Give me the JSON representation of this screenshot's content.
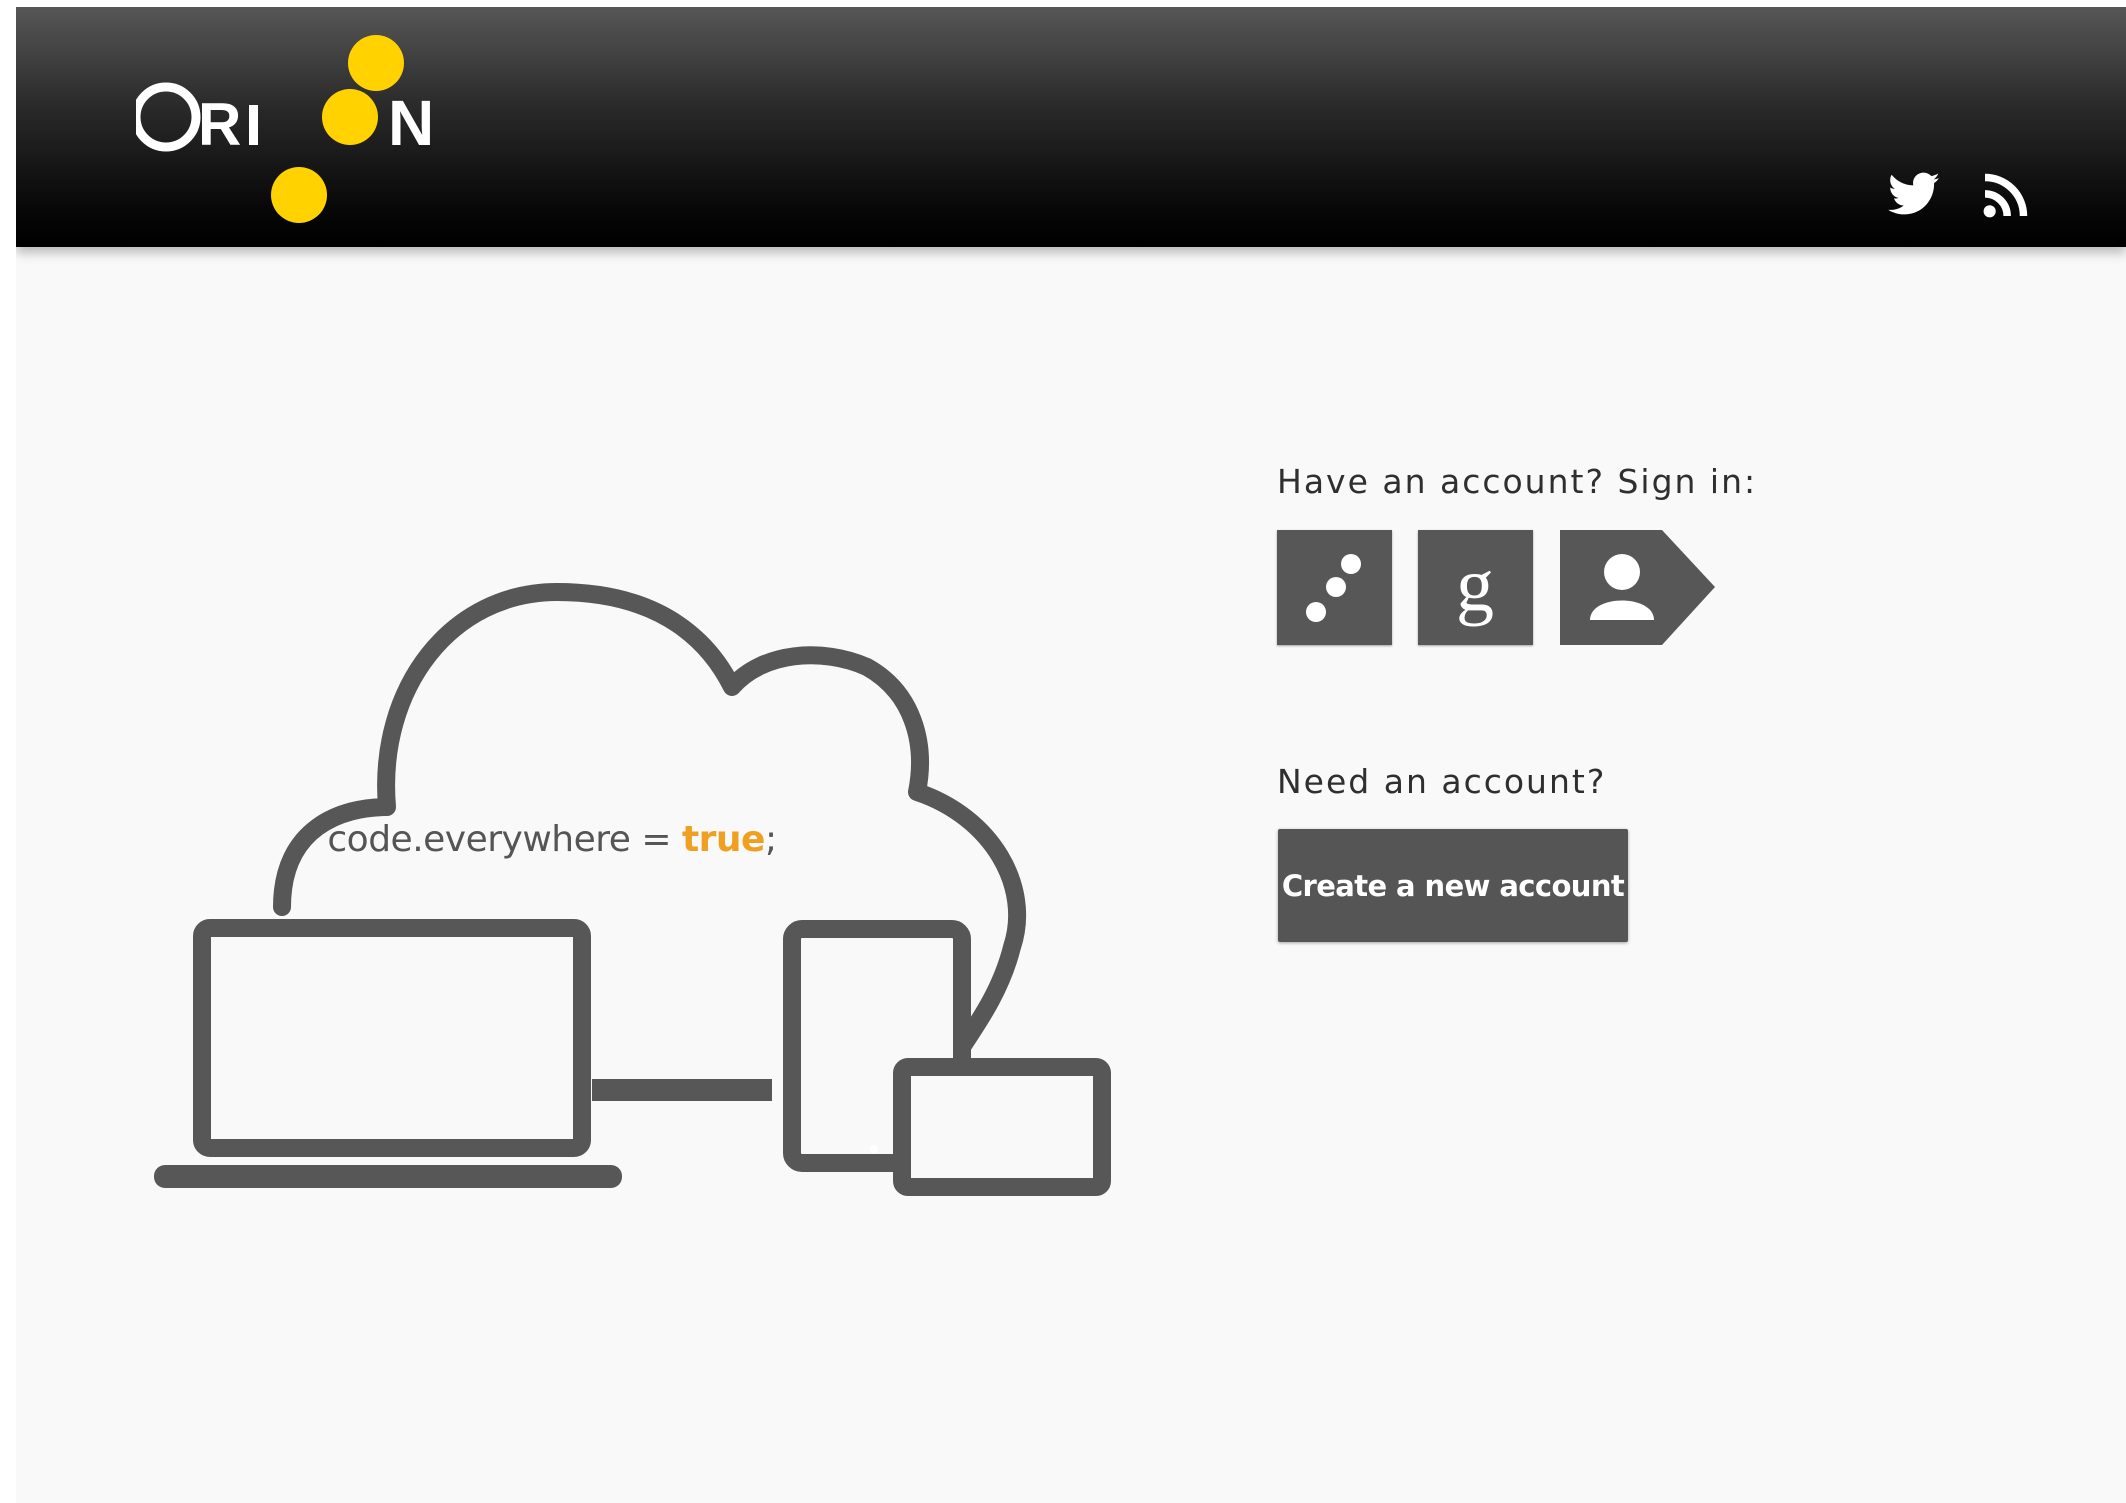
{
  "header": {
    "logo_text": "ORION",
    "logo_accent_color": "#ffd200",
    "social": [
      {
        "name": "Twitter",
        "icon": "twitter-icon"
      },
      {
        "name": "RSS",
        "icon": "rss-icon"
      }
    ]
  },
  "hero": {
    "tagline_prefix": "code.everywhere = ",
    "tagline_accent": "true",
    "tagline_suffix": ";",
    "accent_color": "#f0a020",
    "devices": [
      "laptop-icon",
      "tablet-icon",
      "phone-icon"
    ]
  },
  "signin": {
    "heading": "Have an account? Sign in:",
    "providers": [
      {
        "name": "Orion",
        "icon": "orion-dots-icon"
      },
      {
        "name": "Google",
        "icon": "google-g-icon"
      },
      {
        "name": "Persona",
        "icon": "persona-user-icon"
      }
    ]
  },
  "signup": {
    "heading": "Need an account?",
    "button_label": "Create a new account"
  },
  "colors": {
    "header_bg": "#000000",
    "button_bg": "#555555",
    "page_bg": "#f9f9f9"
  }
}
